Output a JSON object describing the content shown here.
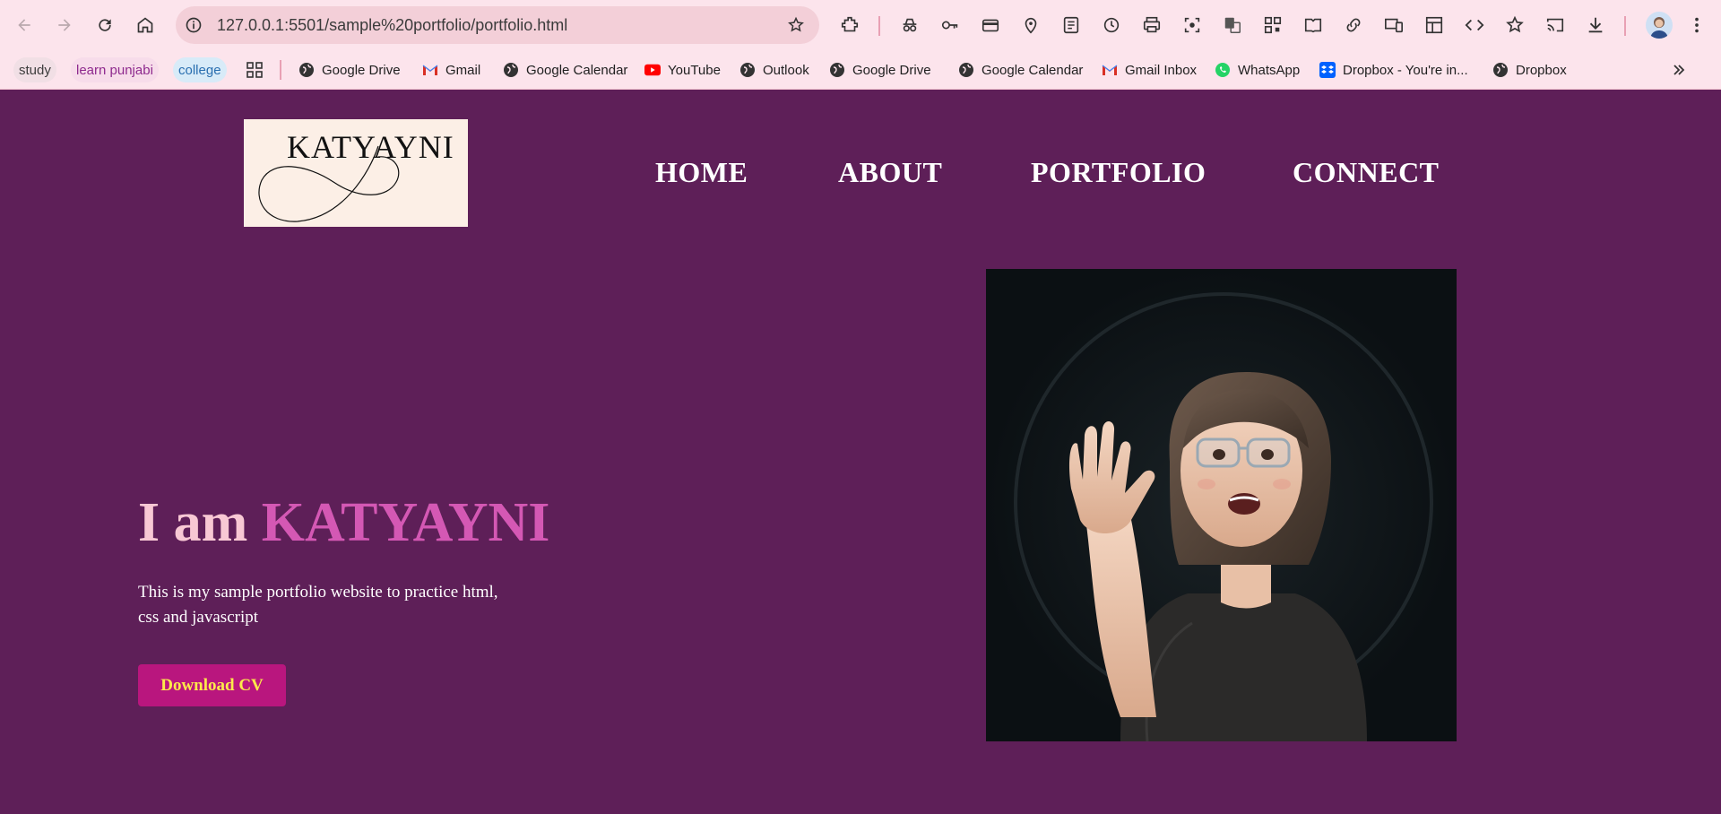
{
  "browser": {
    "url": "127.0.0.1:5501/sample%20portfolio/portfolio.html",
    "toolbar_icons": [
      "back-icon",
      "forward-icon",
      "reload-icon",
      "home-icon",
      "info-icon",
      "bookmark-star-icon",
      "extensions-icon",
      "incognito-icon",
      "password-key-icon",
      "card-icon",
      "location-pin-icon",
      "reading-list-icon",
      "history-icon",
      "print-icon",
      "lens-icon",
      "translate-icon",
      "qr-code-icon",
      "reader-mode-icon",
      "link-icon",
      "devices-icon",
      "layout-icon",
      "code-icon",
      "star-plus-icon",
      "cast-icon",
      "download-icon",
      "profile-avatar-icon",
      "kebab-menu-icon"
    ]
  },
  "bookmarks": {
    "groups": [
      {
        "label": "study",
        "color": "#3d3d3d"
      },
      {
        "label": "learn punjabi",
        "color": "#8e2a8e"
      },
      {
        "label": "college",
        "color": "#2a6fb0"
      }
    ],
    "items": [
      {
        "label": "Google Drive",
        "icon": "globe-icon"
      },
      {
        "label": "Gmail",
        "icon": "gmail-icon"
      },
      {
        "label": "Google Calendar",
        "icon": "globe-icon"
      },
      {
        "label": "YouTube",
        "icon": "youtube-icon"
      },
      {
        "label": "Outlook",
        "icon": "globe-icon"
      },
      {
        "label": "Google Drive",
        "icon": "globe-icon"
      },
      {
        "label": "Google Calendar",
        "icon": "globe-icon"
      },
      {
        "label": "Gmail Inbox",
        "icon": "gmail-icon"
      },
      {
        "label": "WhatsApp",
        "icon": "whatsapp-icon"
      },
      {
        "label": "Dropbox - You're in...",
        "icon": "dropbox-icon"
      },
      {
        "label": "Dropbox",
        "icon": "globe-icon"
      }
    ]
  },
  "page": {
    "logo_text": "KATYAYNI",
    "nav": [
      "HOME",
      "ABOUT",
      "PORTFOLIO",
      "CONNECT"
    ],
    "hero": {
      "prefix": "I am ",
      "name": "KATYAYNI",
      "description": "This is my sample portfolio website to practice html, css and javascript",
      "button": "Download CV"
    },
    "colors": {
      "background": "#5e1f58",
      "title": "#f8c8d4",
      "name_accent": "#d458b4",
      "button_bg": "#b9167e",
      "button_text": "#fce94a"
    }
  }
}
